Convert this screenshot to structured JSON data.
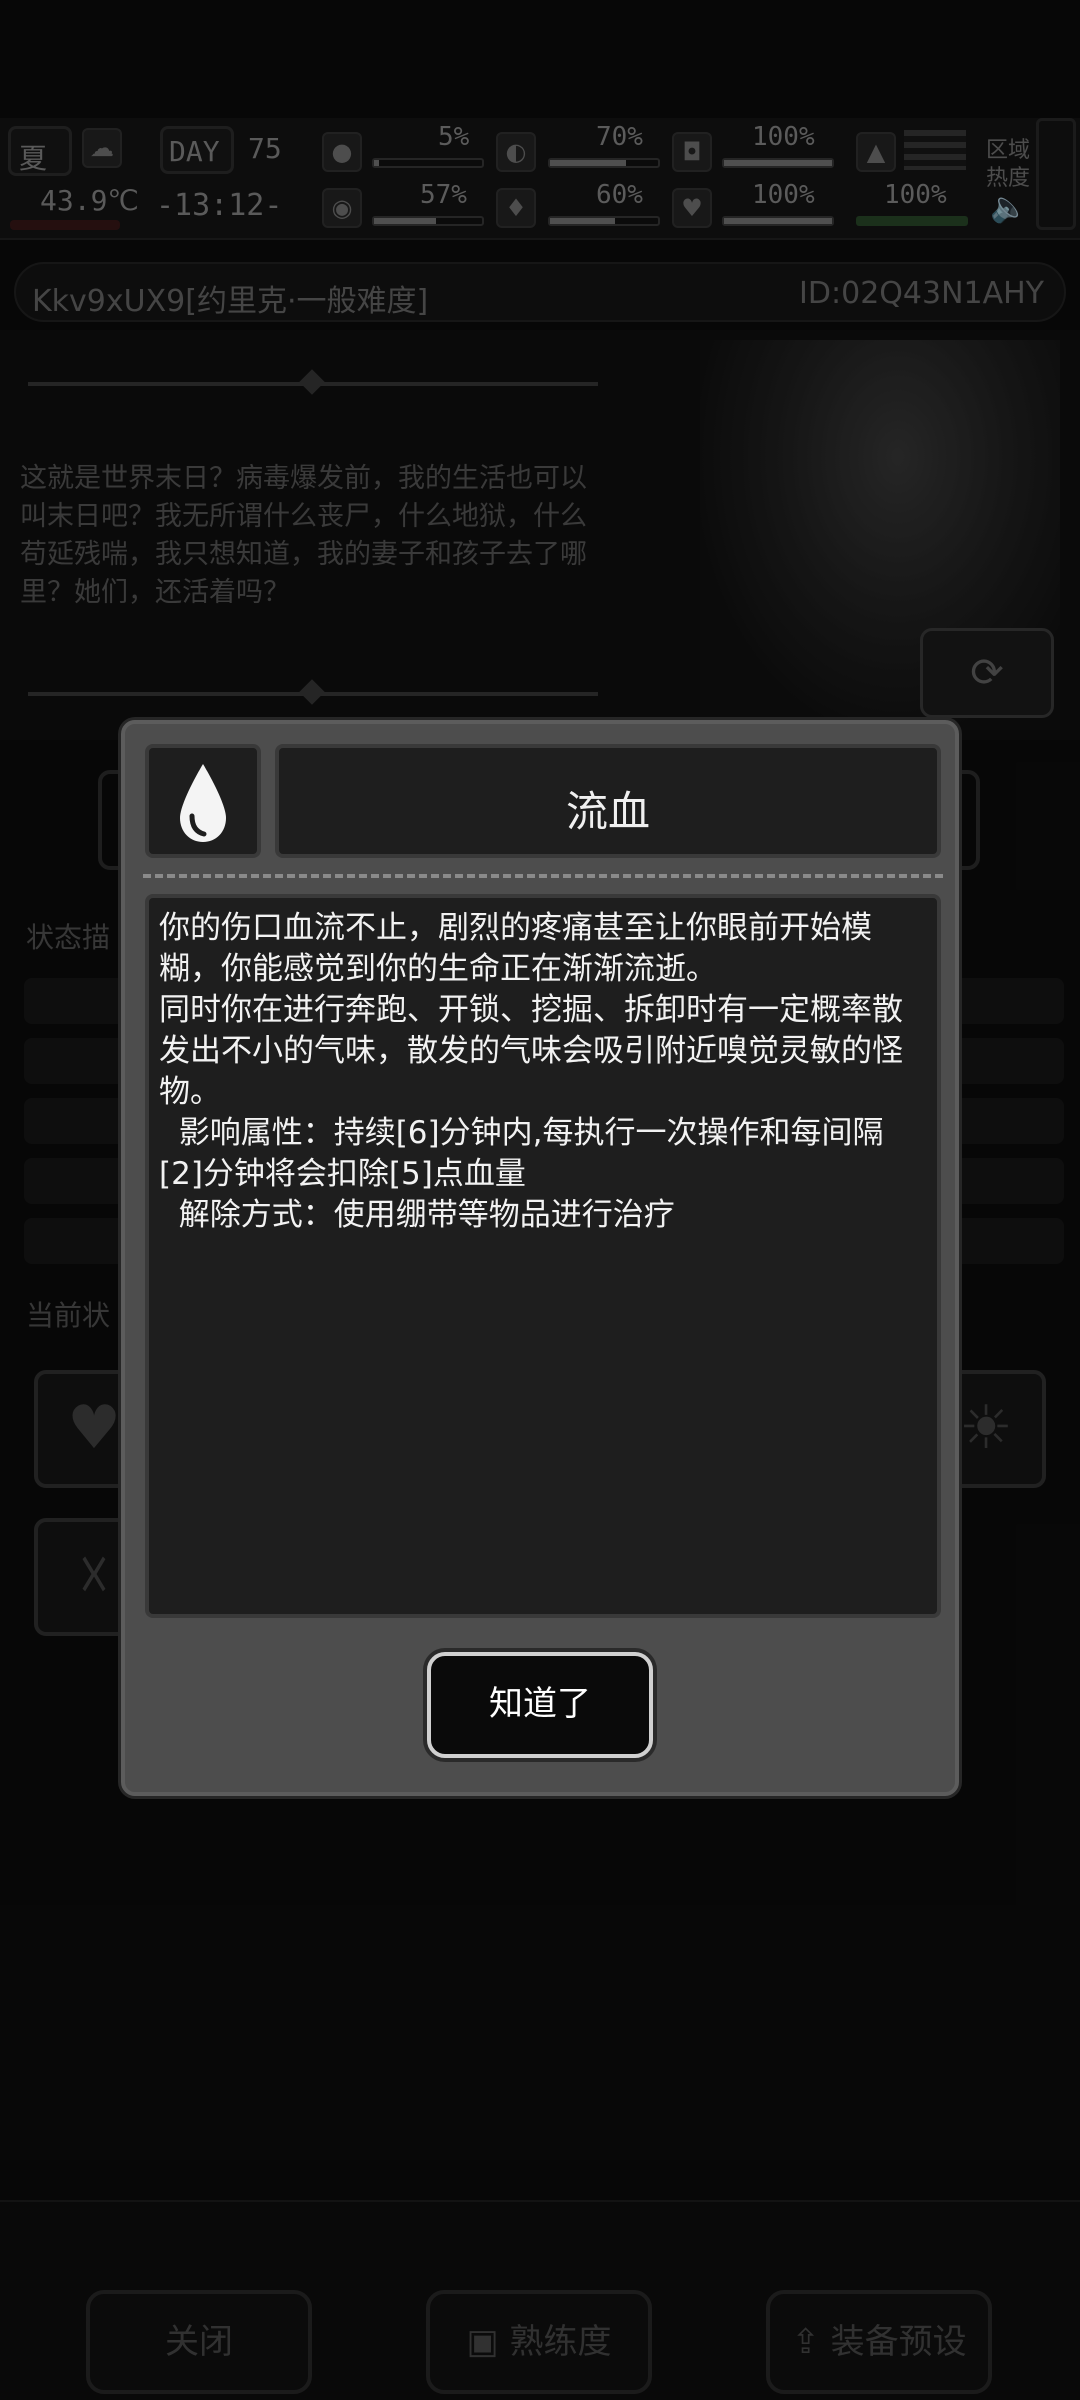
{
  "hud": {
    "season": "夏",
    "day_label": "DAY",
    "day_value": "75",
    "temperature": "43.9℃",
    "clock": "-13:12-",
    "stats": [
      {
        "name": "hunger",
        "value": "5%"
      },
      {
        "name": "stomach",
        "value": "70%"
      },
      {
        "name": "stamina",
        "value": "100%"
      },
      {
        "name": "brain",
        "value": "57%"
      },
      {
        "name": "thirst",
        "value": "60%"
      },
      {
        "name": "health",
        "value": "100%"
      },
      {
        "name": "boot",
        "value": "100%"
      }
    ],
    "zone_label": "区域",
    "heat_label": "热度"
  },
  "profile": {
    "name": "Kkv9xUX9[约里克·一般难度]",
    "id": "ID:02Q43N1AHY"
  },
  "story": {
    "text": "这就是世界末日？病毒爆发前，我的生活也可以叫末日吧？我无所谓什么丧尸，什么地狱，什么苟延残喘，我只想知道，我的妻子和孩子去了哪里？她们，还活着吗？"
  },
  "panel": {
    "status_desc_label": "状态描",
    "current_status_label": "当前状"
  },
  "modal": {
    "title": "流血",
    "description": "你的伤口血流不止，剧烈的疼痛甚至让你眼前开始模糊，你能感觉到你的生命正在渐渐流逝。\n同时你在进行奔跑、开锁、挖掘、拆卸时有一定概率散发出不小的气味，散发的气味会吸引附近嗅觉灵敏的怪物。\n  影响属性：持续[6]分钟内,每执行一次操作和每间隔[2]分钟将会扣除[5]点血量\n  解除方式：使用绷带等物品进行治疗",
    "ok_label": "知道了",
    "icon": "blood-drop-icon"
  },
  "bottom": {
    "close_label": "关闭",
    "proficiency_label": "熟练度",
    "preset_label": "装备预设"
  }
}
